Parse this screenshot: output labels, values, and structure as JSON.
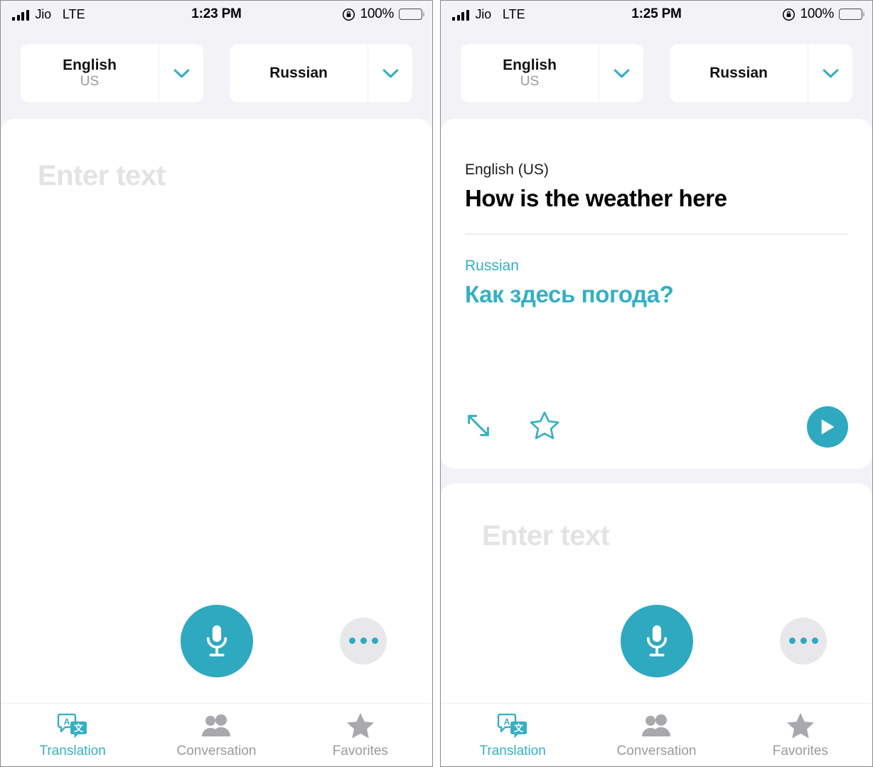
{
  "accent_color": "#2EA9C0",
  "accent_text_color": "#35AFC4",
  "background_color": "#F2F2F7",
  "muted_color": "#9A9AA0",
  "screens": [
    {
      "name": "empty-state",
      "statusbar": {
        "carrier": "Jio",
        "network": "LTE",
        "time": "1:23 PM",
        "battery_percent": "100%",
        "signal_icon": "signal-bars-icon",
        "rotation_lock_icon": "rotation-lock-icon",
        "battery_icon": "battery-full-icon"
      },
      "language_bar": {
        "source": {
          "language": "English",
          "region": "US",
          "chevron_icon": "chevron-down-icon"
        },
        "target": {
          "language": "Russian",
          "region": "",
          "chevron_icon": "chevron-down-icon"
        }
      },
      "has_result": false,
      "input": {
        "placeholder": "Enter text"
      },
      "controls": {
        "mic_icon": "microphone-icon",
        "mic_label": "Record",
        "more_icon": "more-dots-icon",
        "more_label": "More options"
      },
      "tabs": [
        {
          "label": "Translation",
          "icon": "translation-bubbles-icon",
          "active": true
        },
        {
          "label": "Conversation",
          "icon": "two-people-icon",
          "active": false
        },
        {
          "label": "Favorites",
          "icon": "star-filled-icon",
          "active": false
        }
      ]
    },
    {
      "name": "translated-state",
      "statusbar": {
        "carrier": "Jio",
        "network": "LTE",
        "time": "1:25 PM",
        "battery_percent": "100%",
        "signal_icon": "signal-bars-icon",
        "rotation_lock_icon": "rotation-lock-icon",
        "battery_icon": "battery-full-icon"
      },
      "language_bar": {
        "source": {
          "language": "English",
          "region": "US",
          "chevron_icon": "chevron-down-icon"
        },
        "target": {
          "language": "Russian",
          "region": "",
          "chevron_icon": "chevron-down-icon"
        }
      },
      "has_result": true,
      "result": {
        "source_language_label": "English (US)",
        "source_text": "How is the weather here",
        "target_language_label": "Russian",
        "target_text": "Как здесь погода?",
        "actions": {
          "expand_icon": "expand-arrows-icon",
          "expand_label": "Expand",
          "favorite_icon": "star-outline-icon",
          "favorite_label": "Add to favorites",
          "play_icon": "play-icon",
          "play_label": "Play audio"
        }
      },
      "input": {
        "placeholder": "Enter text"
      },
      "controls": {
        "mic_icon": "microphone-icon",
        "mic_label": "Record",
        "more_icon": "more-dots-icon",
        "more_label": "More options"
      },
      "tabs": [
        {
          "label": "Translation",
          "icon": "translation-bubbles-icon",
          "active": true
        },
        {
          "label": "Conversation",
          "icon": "two-people-icon",
          "active": false
        },
        {
          "label": "Favorites",
          "icon": "star-filled-icon",
          "active": false
        }
      ]
    }
  ]
}
